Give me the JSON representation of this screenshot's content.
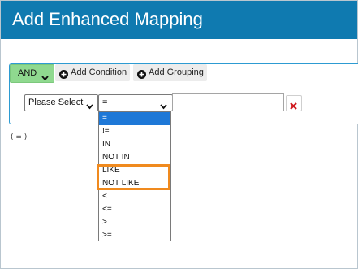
{
  "header": {
    "title": "Add Enhanced Mapping"
  },
  "toolbar": {
    "and_label": "AND",
    "add_condition_label": "Add Condition",
    "add_grouping_label": "Add Grouping"
  },
  "condition": {
    "field_selected": "Please Select",
    "operator_selected": "=",
    "value": ""
  },
  "expression": "( = )",
  "operator_options": [
    "=",
    "!=",
    "IN",
    "NOT IN",
    "LIKE",
    "NOT LIKE",
    "<",
    "<=",
    ">",
    ">="
  ],
  "colors": {
    "header_bg": "#0f7ab0",
    "and_button_bg": "#8fd98f",
    "selected_option_bg": "#1e78d7",
    "highlight_border": "#f08a1e",
    "remove_icon": "#d0191e"
  }
}
